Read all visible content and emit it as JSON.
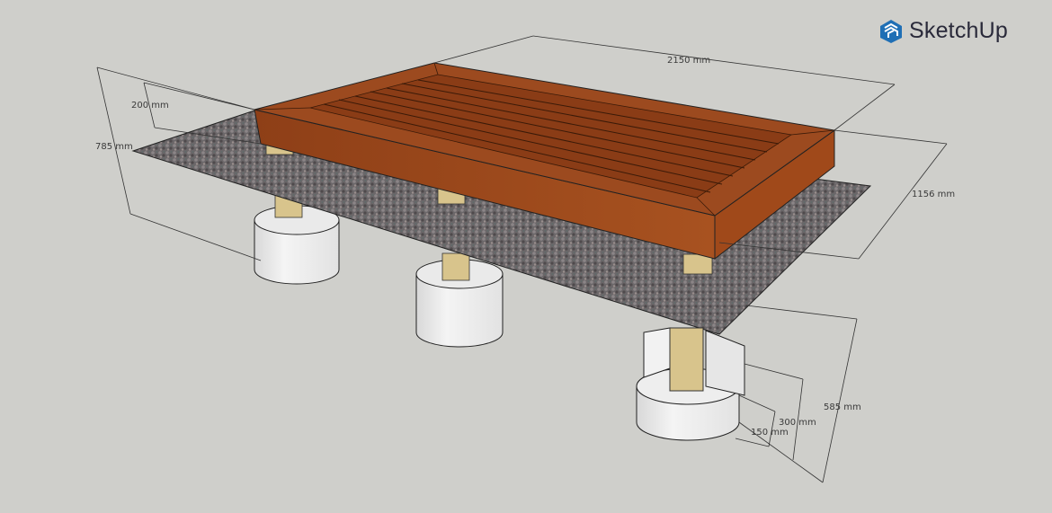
{
  "brand": {
    "name": "SketchUp",
    "color": "#1f6fb5"
  },
  "dimensions": {
    "length": "2150 mm",
    "width": "1156 mm",
    "total_height": "785 mm",
    "deck_height": "200 mm",
    "footing_height": "585 mm",
    "footing_upper": "300 mm",
    "footing_lower": "150 mm"
  },
  "colors": {
    "background": "#cfcfcb",
    "wood": "#9a4a1c",
    "gravel": "#6e6a6c",
    "concrete": "#ececec",
    "post": "#d8c48c"
  }
}
